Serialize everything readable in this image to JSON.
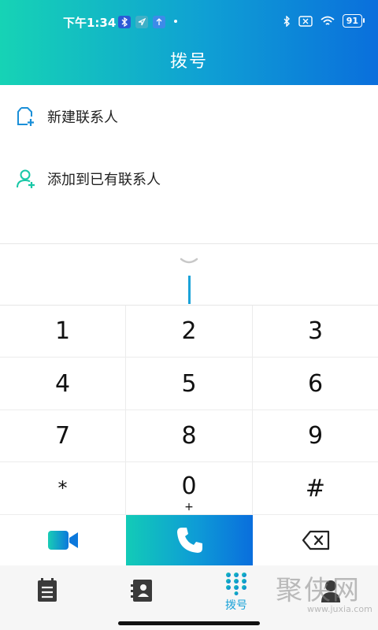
{
  "status_bar": {
    "time": "下午1:34",
    "battery": "91",
    "icons": [
      "bluetooth-badge-icon",
      "location-badge-icon",
      "upload-badge-icon",
      "bluetooth-icon",
      "no-sim-icon",
      "wifi-icon",
      "battery-icon"
    ]
  },
  "header": {
    "title": "拨号"
  },
  "actions": {
    "new_contact": "新建联系人",
    "add_existing": "添加到已有联系人"
  },
  "keypad": {
    "keys": [
      {
        "main": "1",
        "sub": ""
      },
      {
        "main": "2",
        "sub": ""
      },
      {
        "main": "3",
        "sub": ""
      },
      {
        "main": "4",
        "sub": ""
      },
      {
        "main": "5",
        "sub": ""
      },
      {
        "main": "6",
        "sub": ""
      },
      {
        "main": "7",
        "sub": ""
      },
      {
        "main": "8",
        "sub": ""
      },
      {
        "main": "9",
        "sub": ""
      },
      {
        "main": "*",
        "sub": ""
      },
      {
        "main": "0",
        "sub": "+"
      },
      {
        "main": "#",
        "sub": ""
      }
    ]
  },
  "action_bar": {
    "icons": [
      "video-call-icon",
      "phone-icon",
      "backspace-icon"
    ]
  },
  "tabs": {
    "dial_label": "拨号",
    "icons": [
      "call-log-icon",
      "contacts-icon",
      "dialpad-icon",
      "profile-icon"
    ]
  },
  "watermark": {
    "chars": "聚侠网",
    "url": "www.juxia.com"
  },
  "colors": {
    "accent": "#1aa2d8",
    "gradient_start": "#16d3b5",
    "gradient_end": "#0a6fdc"
  }
}
